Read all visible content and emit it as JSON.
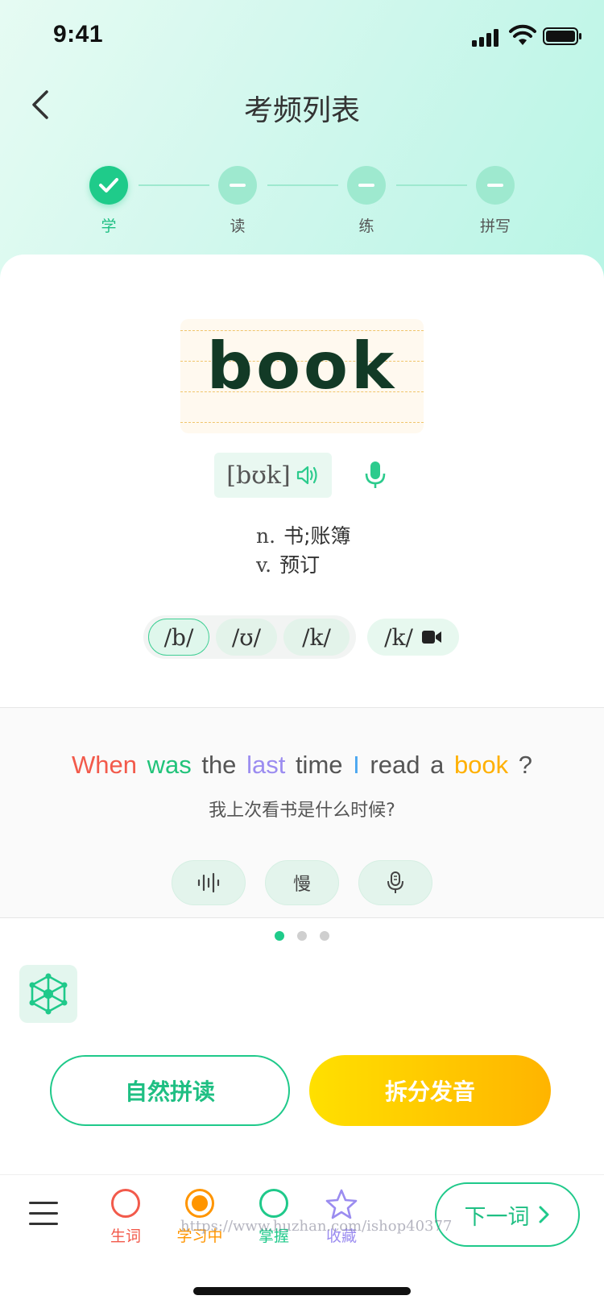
{
  "status_bar": {
    "time": "9:41"
  },
  "header": {
    "title": "考频列表",
    "back_icon": "chevron-left-icon"
  },
  "steps": [
    {
      "label": "学",
      "state": "done"
    },
    {
      "label": "读",
      "state": "todo"
    },
    {
      "label": "练",
      "state": "todo"
    },
    {
      "label": "拼写",
      "state": "todo"
    }
  ],
  "word": {
    "text": "book",
    "phonetic": "[bʊk]",
    "definitions": [
      {
        "pos": "n.",
        "meaning": "书;账簿"
      },
      {
        "pos": "v.",
        "meaning": "预订"
      }
    ]
  },
  "syllables": {
    "items": [
      "/b/",
      "/ʊ/",
      "/k/"
    ],
    "active_index": 0,
    "video_item": "/k/"
  },
  "example": {
    "sentence": [
      {
        "text": "When",
        "color": "#f25a4b"
      },
      {
        "text": "was",
        "color": "#22c37a"
      },
      {
        "text": "the",
        "color": "#555555"
      },
      {
        "text": "last",
        "color": "#9b8cf0"
      },
      {
        "text": "time",
        "color": "#555555"
      },
      {
        "text": "I",
        "color": "#4aa7f0"
      },
      {
        "text": "read",
        "color": "#555555"
      },
      {
        "text": "a",
        "color": "#555555"
      },
      {
        "text": "book",
        "color": "#ffb000"
      },
      {
        "text": "?",
        "color": "#555555"
      }
    ],
    "translation": "我上次看书是什么时候?",
    "buttons": {
      "wave_icon": "waveform-icon",
      "slow_label": "慢",
      "mic_icon": "microphone-icon"
    }
  },
  "pager": {
    "count": 3,
    "active": 0
  },
  "actions": {
    "phonics": "自然拼读",
    "split": "拆分发音"
  },
  "bottom_bar": {
    "tabs": [
      {
        "label": "生词",
        "color": "#f25a4b"
      },
      {
        "label": "学习中",
        "color": "#ff9500"
      },
      {
        "label": "掌握",
        "color": "#1fc98a"
      },
      {
        "label": "收藏",
        "color": "#9b8cf0"
      }
    ],
    "next_label": "下一词"
  },
  "watermark": "https://www.huzhan.com/ishop40377",
  "colors": {
    "accent": "#1fc98a",
    "yellow": "#ffc400"
  }
}
